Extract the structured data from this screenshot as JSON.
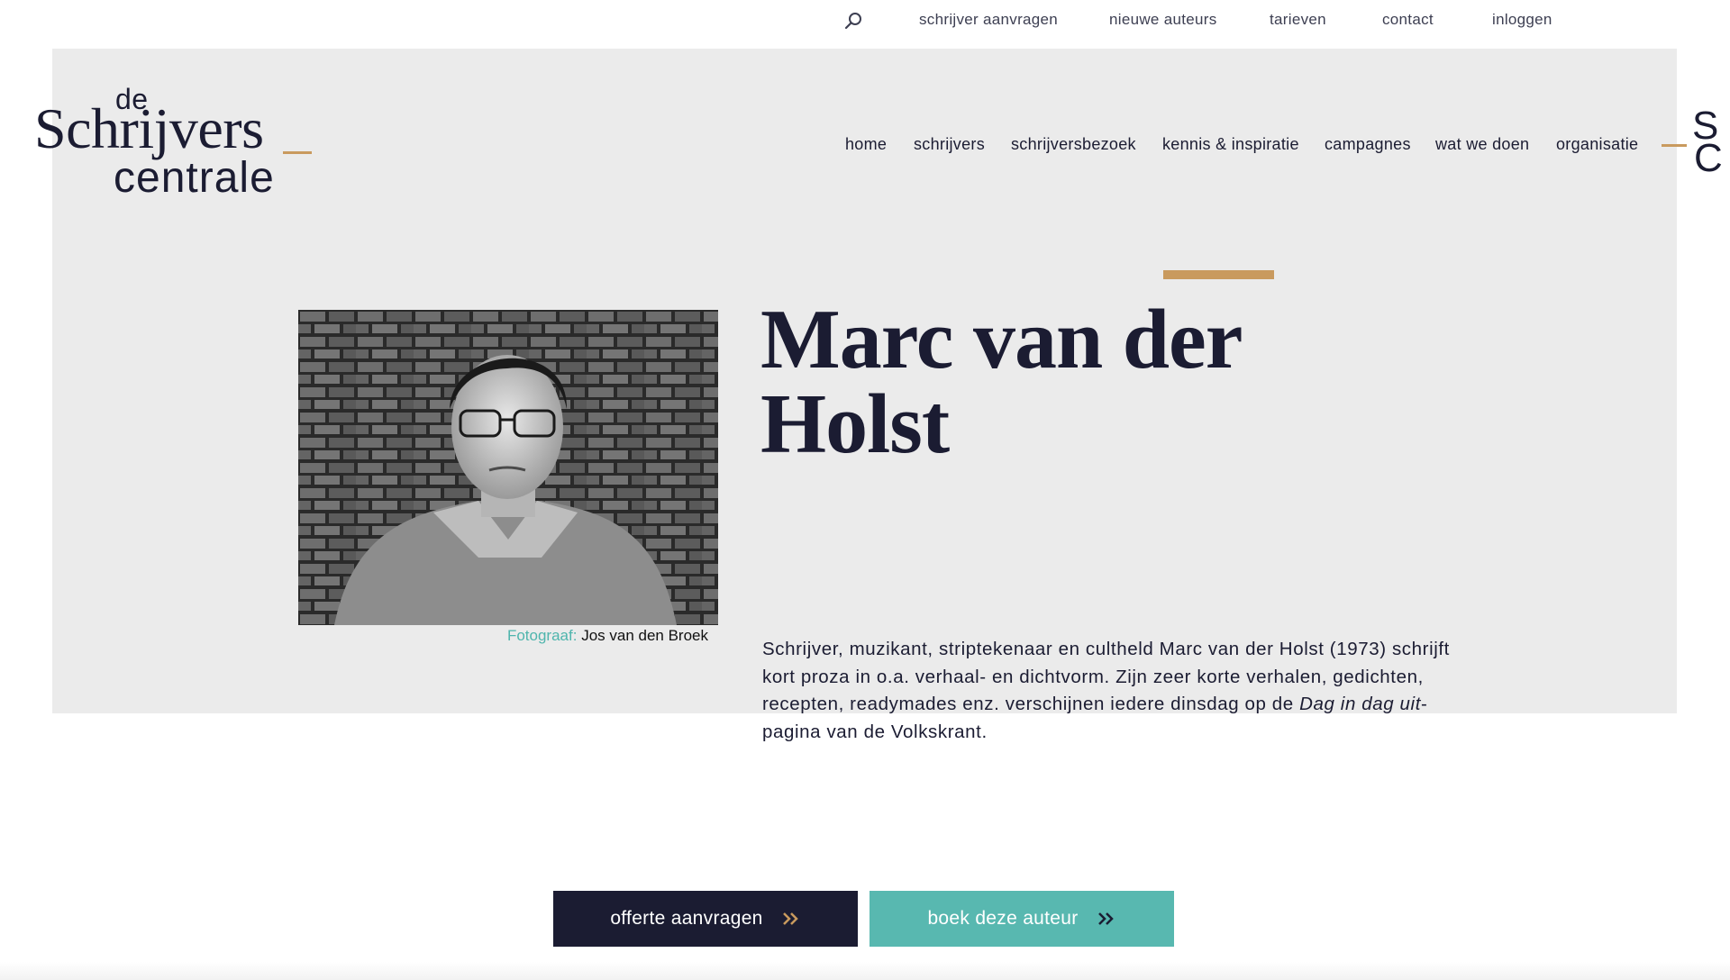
{
  "top_links": {
    "search_icon": "search-icon",
    "request_writer": "schrijver aanvragen",
    "new_authors": "nieuwe auteurs",
    "rates": "tarieven",
    "contact": "contact",
    "login": "inloggen"
  },
  "logo": {
    "line1": "de",
    "line2": "Schrijvers",
    "line3": "centrale",
    "accent_color": "#c99a5e"
  },
  "nav": {
    "home": "home",
    "writers": "schrijvers",
    "writer_visit": "schrijversbezoek",
    "knowledge": "kennis & inspiratie",
    "campaigns": "campagnes",
    "what_we_do": "wat we doen",
    "organisation": "organisatie"
  },
  "edge_mark": {
    "s": "S",
    "c": "C"
  },
  "author": {
    "name": "Marc van der Holst",
    "photo_caption_label": "Fotograaf:",
    "photo_caption_name": "Jos van den Broek",
    "bio_part1": "Schrijver, muzikant, striptekenaar en cultheld Marc van der Holst (1973) schrijft kort proza in o.a. verhaal- en dichtvorm. Zijn zeer korte verhalen, gedichten, recepten, readymades enz. verschijnen iedere dinsdag op de ",
    "bio_italic": "Dag in dag uit",
    "bio_part2": "-pagina van de Volkskrant."
  },
  "buttons": {
    "quote": "offerte aanvragen",
    "book": "boek deze auteur"
  },
  "colors": {
    "navy": "#1b1c32",
    "gold": "#c99a5e",
    "teal": "#58b8b0",
    "hero_bg": "#ebebeb"
  }
}
